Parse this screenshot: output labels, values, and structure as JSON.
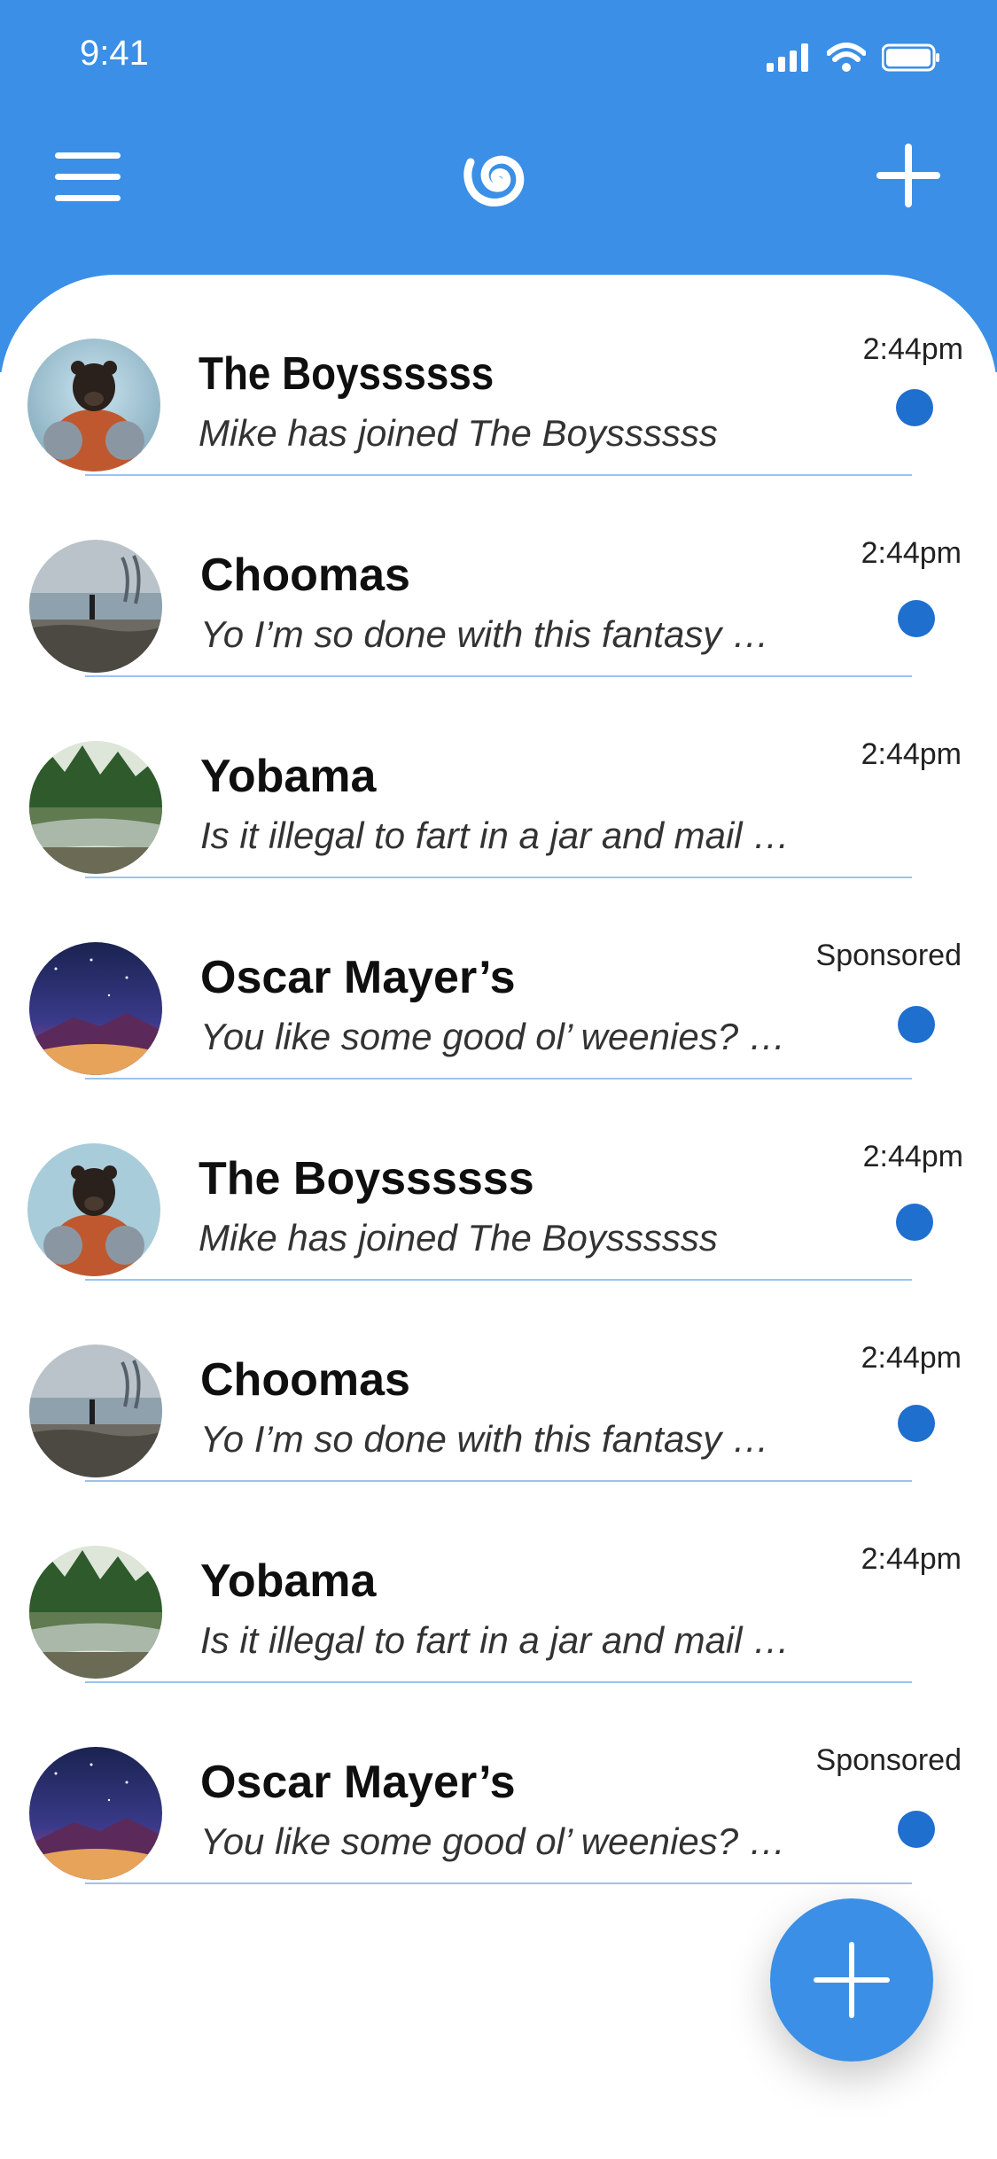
{
  "status": {
    "time": "9:41"
  },
  "header": {
    "menu_icon": "hamburger-menu-icon",
    "logo_icon": "spiral-logo-icon",
    "add_icon": "plus-icon",
    "bg_color": "#3b8fe6"
  },
  "conversations": [
    {
      "title": "The Boyssssss",
      "preview": "Mike has joined The Boyssssss",
      "meta": "2:44pm",
      "unread": true,
      "avatar": "astronaut-bear"
    },
    {
      "title": "Choomas",
      "preview": "Yo I’m so done with this fantasy …",
      "meta": "2:44pm",
      "unread": true,
      "avatar": "foggy-shore"
    },
    {
      "title": "Yobama",
      "preview": "Is it illegal to fart in a jar and mail …",
      "meta": "2:44pm",
      "unread": false,
      "avatar": "forest-river"
    },
    {
      "title": "Oscar Mayer’s",
      "preview": "You like some good ol’ weenies? …",
      "meta": "Sponsored",
      "unread": true,
      "avatar": "starry-night"
    },
    {
      "title": "The Boyssssss",
      "preview": "Mike has joined The Boyssssss",
      "meta": "2:44pm",
      "unread": true,
      "avatar": "astronaut-bear"
    },
    {
      "title": "Choomas",
      "preview": "Yo I’m so done with this fantasy …",
      "meta": "2:44pm",
      "unread": true,
      "avatar": "foggy-shore"
    },
    {
      "title": "Yobama",
      "preview": "Is it illegal to fart in a jar and mail …",
      "meta": "2:44pm",
      "unread": false,
      "avatar": "forest-river"
    },
    {
      "title": "Oscar Mayer’s",
      "preview": "You like some good ol’ weenies? …",
      "meta": "Sponsored",
      "unread": true,
      "avatar": "starry-night"
    }
  ],
  "fab": {
    "icon": "plus-icon"
  },
  "colors": {
    "accent": "#3b8fe6",
    "unread_dot": "#1f6fcf",
    "divider": "#9cc3ef"
  }
}
